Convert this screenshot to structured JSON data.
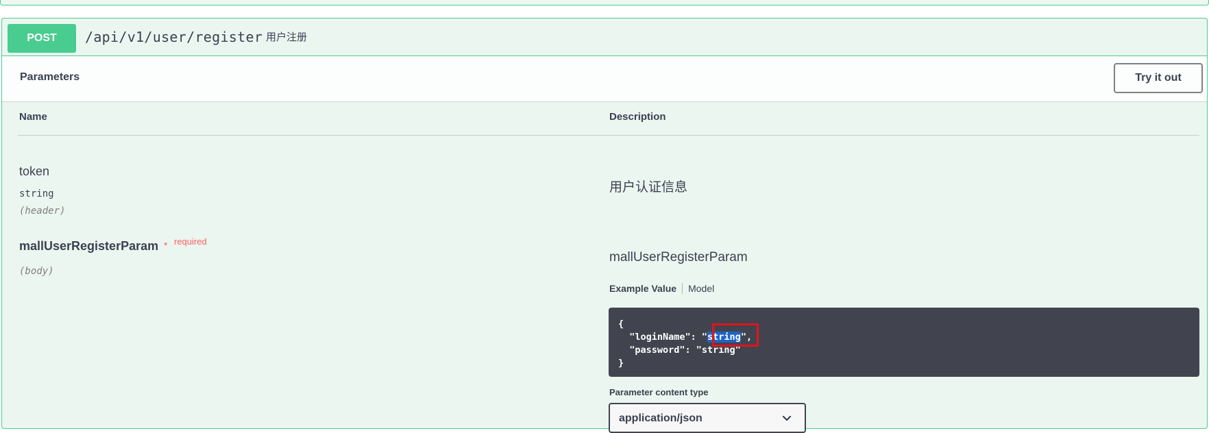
{
  "operation": {
    "method": "POST",
    "path": "/api/v1/user/register",
    "summary": "用户注册"
  },
  "parameters_section": {
    "title": "Parameters",
    "try_button": "Try it out",
    "col_name": "Name",
    "col_description": "Description"
  },
  "params": [
    {
      "name": "token",
      "type": "string",
      "in": "(header)",
      "description": "用户认证信息"
    },
    {
      "name": "mallUserRegisterParam",
      "required_star": "*",
      "required_label": "required",
      "in": "(body)",
      "description": "mallUserRegisterParam"
    }
  ],
  "example": {
    "tab_example": "Example Value",
    "tab_model": "Model",
    "line1": "{",
    "line2_prefix": "  \"loginName\": \"",
    "line2_selected": "string",
    "line2_suffix": "\",",
    "line3": "  \"password\": \"string\"",
    "line4": "}"
  },
  "content_type": {
    "label": "Parameter content type",
    "value": "application/json"
  },
  "colors": {
    "post_green": "#49cc90",
    "block_bg": "#ebf6f0",
    "code_bg": "#41444e",
    "selection": "#1f63c4",
    "highlight_box": "#e0141b",
    "required_red": "#ff6060"
  }
}
